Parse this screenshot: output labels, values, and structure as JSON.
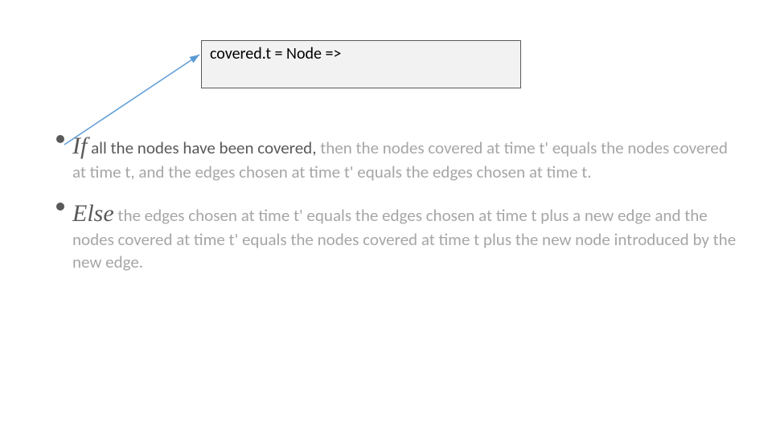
{
  "codebox": {
    "text": "covered.t = Node =>"
  },
  "content": {
    "if": {
      "keyword": "If",
      "dark": " all the nodes have been covered,",
      "rest": " then the nodes covered at time t' equals the nodes covered at time t, and the edges chosen at time t' equals the edges chosen at time t."
    },
    "else": {
      "keyword": "Else",
      "dark": "",
      "rest": " the edges chosen at time t' equals the edges chosen at time t plus a new edge and the nodes covered at time t' equals the nodes covered at time t plus the new node introduced by the new edge."
    }
  },
  "accent_color": "#5b9bd5"
}
